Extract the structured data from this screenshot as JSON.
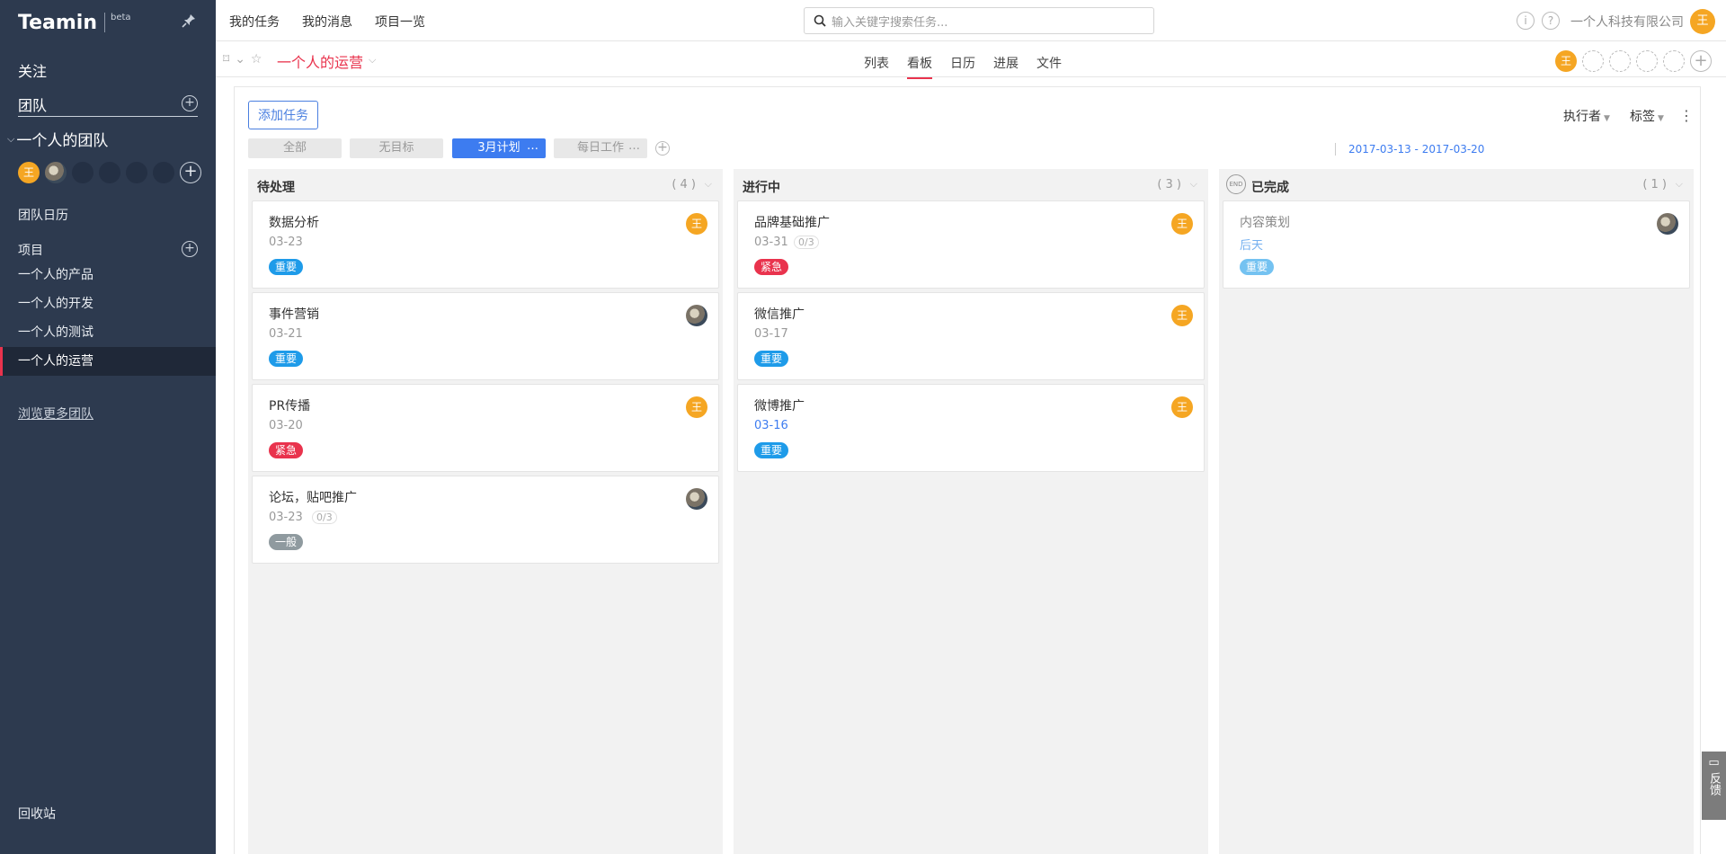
{
  "sidebar": {
    "brand": "Teamin",
    "beta": "beta",
    "follow": "关注",
    "team": "团队",
    "group": "一个人的团队",
    "avatar_letter": "王",
    "team_calendar": "团队日历",
    "projects_label": "项目",
    "projects": [
      "一个人的产品",
      "一个人的开发",
      "一个人的测试",
      "一个人的运营"
    ],
    "more_teams": "浏览更多团队",
    "trash": "回收站"
  },
  "topbar": {
    "links": [
      "我的任务",
      "我的消息",
      "项目一览"
    ],
    "search_placeholder": "输入关键字搜索任务...",
    "company": "一个人科技有限公司",
    "user_letter": "王"
  },
  "project": {
    "title": "一个人的运营",
    "views": [
      "列表",
      "看板",
      "日历",
      "进展",
      "文件"
    ],
    "active_view": "看板",
    "member_letter": "王"
  },
  "board": {
    "add_task": "添加任务",
    "assignee_filter": "执行者",
    "tag_filter": "标签",
    "plans": [
      "全部",
      "无目标",
      "3月计划",
      "每日工作"
    ],
    "active_plan": "3月计划",
    "date_range": "2017-03-13 - 2017-03-20",
    "columns": [
      {
        "title": "待处理",
        "count": "( 4 )",
        "cards": [
          {
            "title": "数据分析",
            "date": "03-23",
            "badge": "重要",
            "avatar": "王"
          },
          {
            "title": "事件营销",
            "date": "03-21",
            "badge": "重要",
            "avatar": ""
          },
          {
            "title": "PR传播",
            "date": "03-20",
            "badge": "紧急",
            "avatar": "王"
          },
          {
            "title": "论坛，贴吧推广",
            "date": "03-23",
            "sub": "0/3",
            "badge": "一般",
            "avatar": ""
          }
        ]
      },
      {
        "title": "进行中",
        "count": "( 3 )",
        "cards": [
          {
            "title": "品牌基础推广",
            "date": "03-31",
            "sub": "0/3",
            "badge": "紧急",
            "avatar": "王"
          },
          {
            "title": "微信推广",
            "date": "03-17",
            "badge": "重要",
            "avatar": "王"
          },
          {
            "title": "微博推广",
            "date": "03-16",
            "badge": "重要",
            "avatar": "王"
          }
        ]
      },
      {
        "title": "已完成",
        "count": "( 1 )",
        "end_label": "END",
        "cards": [
          {
            "title": "内容策划",
            "date": "后天",
            "badge": "重要",
            "avatar": ""
          }
        ]
      }
    ]
  },
  "feedback": "反馈"
}
